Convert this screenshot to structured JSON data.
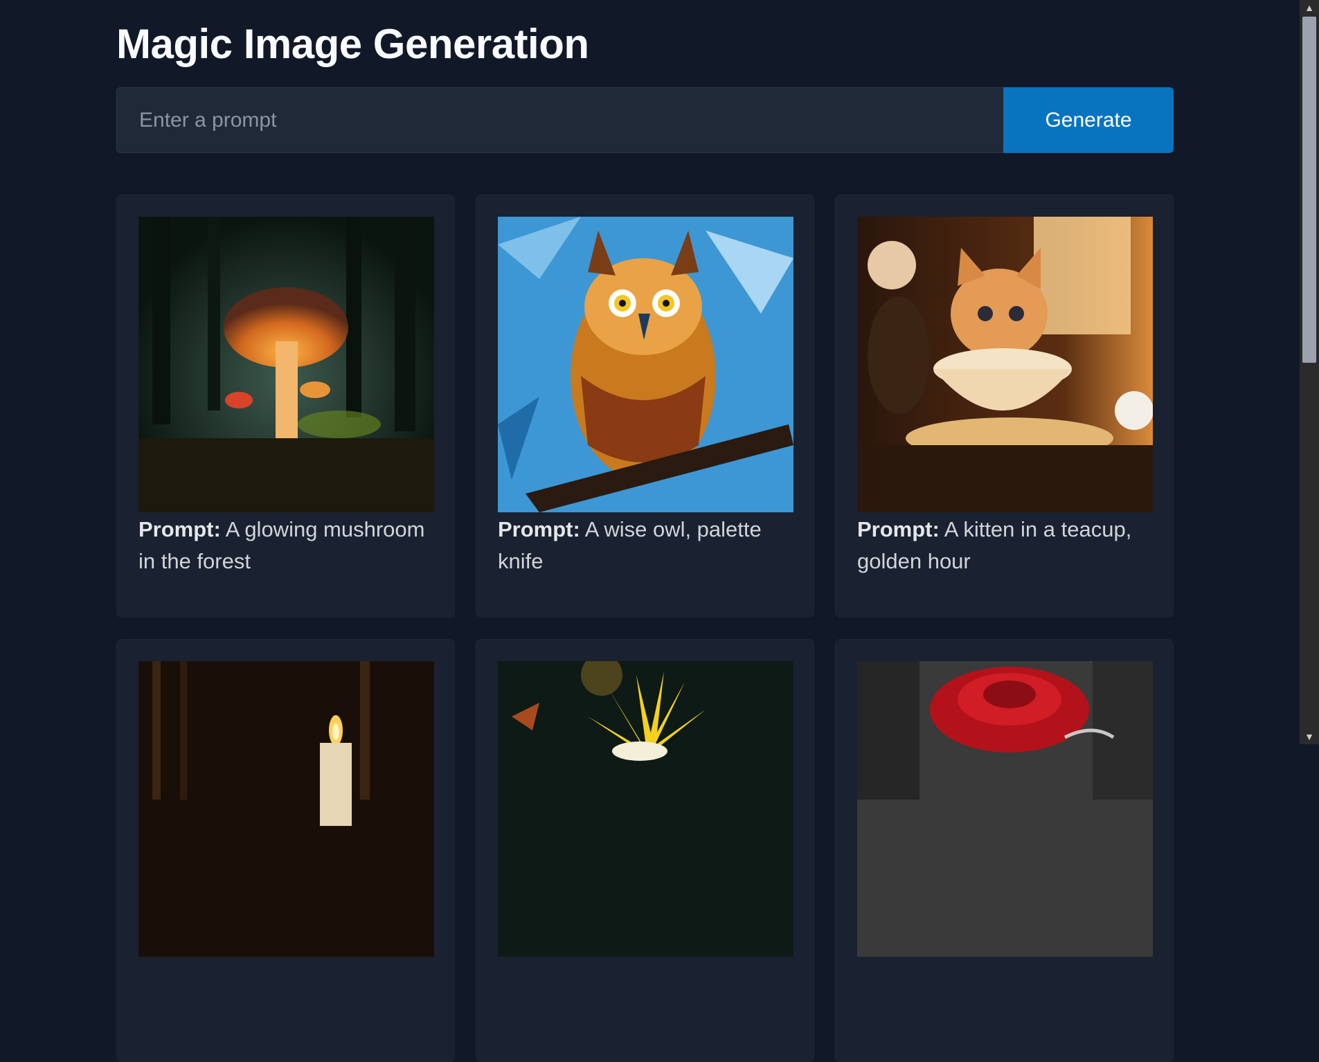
{
  "header": {
    "title": "Magic Image Generation"
  },
  "prompt_bar": {
    "placeholder": "Enter a prompt",
    "value": "",
    "button_label": "Generate"
  },
  "gallery": {
    "prompt_label": "Prompt:",
    "cards": [
      {
        "prompt": "A glowing mushroom in the forest",
        "image": "glowing-mushroom-forest"
      },
      {
        "prompt": "A wise owl, palette knife",
        "image": "owl-palette-knife-painting"
      },
      {
        "prompt": "A kitten in a teacup, golden hour",
        "image": "kitten-in-teacup"
      },
      {
        "prompt": "",
        "image": "candle-in-dark"
      },
      {
        "prompt": "",
        "image": "yellow-flower"
      },
      {
        "prompt": "",
        "image": "red-rose"
      }
    ]
  },
  "colors": {
    "background": "#111827",
    "card": "#1a2130",
    "accent": "#0874c0"
  }
}
